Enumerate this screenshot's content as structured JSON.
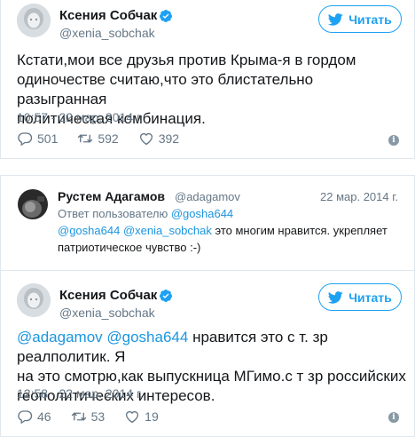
{
  "tweet1": {
    "name": "Ксения Собчак",
    "handle": "@xenia_sobchak",
    "follow_label": "Читать",
    "text": "Кстати,мои все друзья против Крыма-я в гордом одиночестве считаю,что это блистательно разыгранная политическая комбинация.",
    "text_lines": [
      "Кстати,мои все друзья против Крыма-я в гордом",
      "одиночестве считаю,что это блистательно разыгранная",
      "политическая комбинация."
    ],
    "time": "10:57 - 22 мар. 2014 г.",
    "replies": "501",
    "retweets": "592",
    "likes": "392"
  },
  "reply": {
    "name": "Рустем Адагамов",
    "handle": "@adagamov",
    "date": "22 мар. 2014 г.",
    "reply_to_prefix": "Ответ пользователю",
    "reply_to_user": "@gosha644",
    "mention1": "@gosha644",
    "mention2": "@xenia_sobchak",
    "text_rest": "это многим нравится. укрепляет",
    "text_line2": "патриотическое чувство :-)"
  },
  "tweet2": {
    "name": "Ксения Собчак",
    "handle": "@xenia_sobchak",
    "follow_label": "Читать",
    "mention1": "@adagamov",
    "mention2": "@gosha644",
    "text_rest1": "нравится это с т. зр реалполитик. Я",
    "text_line2": "на это смотрю,как выпускница МГимо.с т зр российских",
    "text_line3": "геополитических интересов.",
    "time": "12:58 - 22 мар. 2014 г.",
    "replies": "46",
    "retweets": "53",
    "likes": "19"
  },
  "colors": {
    "accent": "#1da1f2",
    "link": "#1b95e0",
    "muted": "#657786",
    "border": "#e1e8ed"
  },
  "icons": [
    "avatar",
    "verified-badge-icon",
    "twitter-bird-icon",
    "reply-icon",
    "retweet-icon",
    "heart-icon",
    "info-icon"
  ]
}
